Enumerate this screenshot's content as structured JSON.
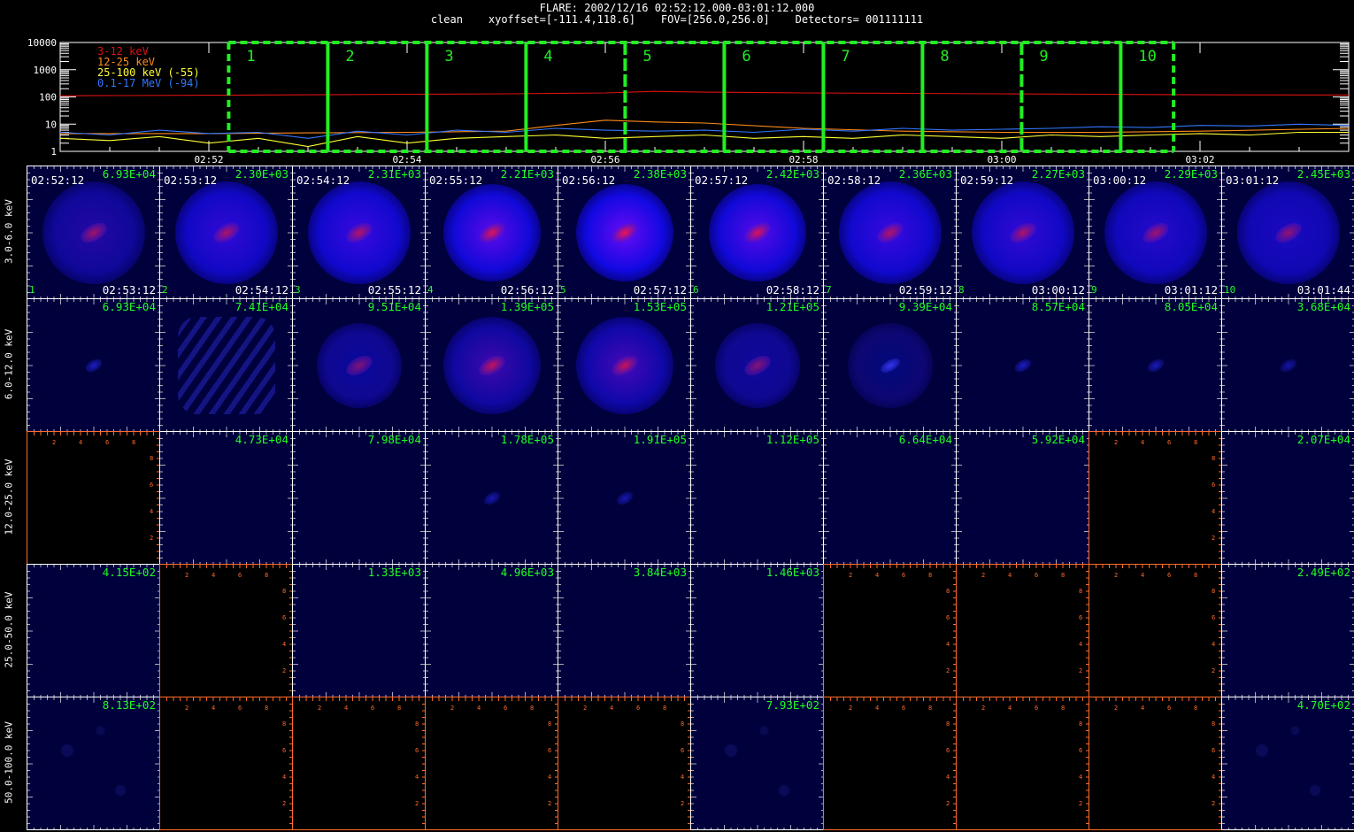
{
  "header": {
    "title": "FLARE: 2002/12/16 02:52:12.000-03:01:12.000",
    "params": "clean    xyoffset=[-111.4,118.6]    FOV=[256.0,256.0]    Detectors= 001111111"
  },
  "chart_data": [
    {
      "type": "line",
      "title": "",
      "xlabel": "",
      "ylabel": "",
      "y_scale": "log",
      "ylim": [
        1,
        10000
      ],
      "y_tick_labels": [
        "1",
        "10",
        "100",
        "1000",
        "10000"
      ],
      "xlim": [
        "02:50:30",
        "03:03:30"
      ],
      "x_tick_labels": [
        "02:52",
        "02:54",
        "02:56",
        "02:58",
        "03:00",
        "03:02"
      ],
      "legend_position": "top-left",
      "series": [
        {
          "name": "3-12 keV",
          "color": "#dd1111",
          "x": [
            "02:50:30",
            "02:52:00",
            "02:53:00",
            "02:54:00",
            "02:55:00",
            "02:56:00",
            "02:56:30",
            "02:57:00",
            "02:58:00",
            "02:59:00",
            "03:00:00",
            "03:01:00",
            "03:02:00",
            "03:03:30"
          ],
          "y": [
            110,
            115,
            120,
            125,
            130,
            140,
            160,
            150,
            140,
            135,
            130,
            125,
            120,
            118
          ]
        },
        {
          "name": "12-25 keV",
          "color": "#ff8c1a",
          "x": [
            "02:50:30",
            "02:52:00",
            "02:53:00",
            "02:54:00",
            "02:55:00",
            "02:55:30",
            "02:56:00",
            "02:56:30",
            "02:57:00",
            "02:58:00",
            "02:59:00",
            "03:00:00",
            "03:01:00",
            "03:02:00",
            "03:03:30"
          ],
          "y": [
            4.5,
            4.5,
            4.8,
            5,
            5.5,
            9,
            14,
            12,
            11,
            7,
            5.5,
            5,
            5,
            5.5,
            7
          ]
        },
        {
          "name": "25-100 keV (-55)",
          "color": "#ffff33",
          "x": [
            "02:50:30",
            "02:51:00",
            "02:51:30",
            "02:52:00",
            "02:52:30",
            "02:53:00",
            "02:53:30",
            "02:54:00",
            "02:54:30",
            "02:55:00",
            "02:55:30",
            "02:56:00",
            "02:56:30",
            "02:57:00",
            "02:57:30",
            "02:58:00",
            "02:58:30",
            "02:59:00",
            "02:59:30",
            "03:00:00",
            "03:00:30",
            "03:01:00",
            "03:01:30",
            "03:02:00",
            "03:02:30",
            "03:03:00",
            "03:03:30"
          ],
          "y": [
            3,
            2.5,
            3.5,
            2,
            3,
            1.5,
            3.5,
            2,
            3,
            3.5,
            4,
            3,
            3.5,
            4,
            3,
            3.5,
            3,
            4,
            3.5,
            3,
            4,
            3.5,
            4,
            4.5,
            4,
            5,
            5
          ]
        },
        {
          "name": "0.1-17 MeV (-94)",
          "color": "#3377ff",
          "x": [
            "02:50:30",
            "02:51:00",
            "02:51:30",
            "02:52:00",
            "02:52:30",
            "02:53:00",
            "02:53:30",
            "02:54:00",
            "02:54:30",
            "02:55:00",
            "02:55:30",
            "02:56:00",
            "02:56:30",
            "02:57:00",
            "02:57:30",
            "02:58:00",
            "02:58:30",
            "02:59:00",
            "02:59:30",
            "03:00:00",
            "03:00:30",
            "03:01:00",
            "03:01:30",
            "03:02:00",
            "03:02:30",
            "03:03:00",
            "03:03:30"
          ],
          "y": [
            5,
            4,
            6,
            4.5,
            5,
            3,
            5.5,
            4,
            6,
            5,
            7,
            6,
            5.5,
            6,
            5,
            6.5,
            5.5,
            7,
            6,
            6.5,
            7,
            8,
            7.5,
            9,
            8.5,
            10,
            9
          ]
        }
      ],
      "intervals": [
        {
          "label": "1",
          "start": "02:52:12",
          "end": "02:53:12"
        },
        {
          "label": "2",
          "start": "02:53:12",
          "end": "02:54:12"
        },
        {
          "label": "3",
          "start": "02:54:12",
          "end": "02:55:12"
        },
        {
          "label": "4",
          "start": "02:55:12",
          "end": "02:56:12"
        },
        {
          "label": "5",
          "start": "02:56:12",
          "end": "02:57:12"
        },
        {
          "label": "6",
          "start": "02:57:12",
          "end": "02:58:12"
        },
        {
          "label": "7",
          "start": "02:58:12",
          "end": "02:59:12"
        },
        {
          "label": "8",
          "start": "02:59:12",
          "end": "03:00:12"
        },
        {
          "label": "9",
          "start": "03:00:12",
          "end": "03:01:12"
        },
        {
          "label": "10",
          "start": "03:01:12",
          "end": "03:01:44"
        }
      ]
    }
  ],
  "image_grid": {
    "rows": [
      {
        "label": "3.0-6.0 keV",
        "panels": [
          {
            "max": "6.93E+04",
            "start": "02:52:12",
            "index": "1",
            "end": "02:53:12",
            "style": "blue",
            "source": "diffuse",
            "intensity": 0.55,
            "core": 0.35
          },
          {
            "max": "2.30E+03",
            "start": "02:53:12",
            "index": "2",
            "end": "02:54:12",
            "style": "blue",
            "source": "diffuse",
            "intensity": 0.8,
            "core": 0.45
          },
          {
            "max": "2.31E+03",
            "start": "02:54:12",
            "index": "3",
            "end": "02:55:12",
            "style": "blue",
            "source": "diffuse",
            "intensity": 0.85,
            "core": 0.5
          },
          {
            "max": "2.21E+03",
            "start": "02:55:12",
            "index": "4",
            "end": "02:56:12",
            "style": "blue",
            "source": "ring",
            "intensity": 0.9,
            "core": 0.8
          },
          {
            "max": "2.38E+03",
            "start": "02:56:12",
            "index": "5",
            "end": "02:57:12",
            "style": "blue",
            "source": "ring",
            "intensity": 0.95,
            "core": 0.9
          },
          {
            "max": "2.42E+03",
            "start": "02:57:12",
            "index": "6",
            "end": "02:58:12",
            "style": "blue",
            "source": "ring",
            "intensity": 0.9,
            "core": 0.75
          },
          {
            "max": "2.36E+03",
            "start": "02:58:12",
            "index": "7",
            "end": "02:59:12",
            "style": "blue",
            "source": "diffuse",
            "intensity": 0.85,
            "core": 0.5
          },
          {
            "max": "2.27E+03",
            "start": "02:59:12",
            "index": "8",
            "end": "03:00:12",
            "style": "blue",
            "source": "diffuse",
            "intensity": 0.8,
            "core": 0.45
          },
          {
            "max": "2.29E+03",
            "start": "03:00:12",
            "index": "9",
            "end": "03:01:12",
            "style": "blue",
            "source": "diffuse",
            "intensity": 0.75,
            "core": 0.35
          },
          {
            "max": "2.45E+03",
            "start": "03:01:12",
            "index": "10",
            "end": "03:01:44",
            "style": "blue",
            "source": "diffuse",
            "intensity": 0.7,
            "core": 0.25
          }
        ]
      },
      {
        "label": "6.0-12.0 keV",
        "panels": [
          {
            "max": "6.93E+04",
            "style": "blue",
            "source": "point",
            "intensity": 0.3,
            "core": 0
          },
          {
            "max": "7.41E+04",
            "style": "blue",
            "source": "fringes",
            "intensity": 0.35,
            "core": 0
          },
          {
            "max": "9.51E+04",
            "style": "blue",
            "source": "faint-ring",
            "intensity": 0.5,
            "core": 0.1
          },
          {
            "max": "1.39E+05",
            "style": "blue",
            "source": "ring",
            "intensity": 0.6,
            "core": 0.6
          },
          {
            "max": "1.53E+05",
            "style": "blue",
            "source": "ring",
            "intensity": 0.65,
            "core": 0.65
          },
          {
            "max": "1.21E+05",
            "style": "blue",
            "source": "faint-ring",
            "intensity": 0.5,
            "core": 0.15
          },
          {
            "max": "9.39E+04",
            "style": "blue",
            "source": "faint-ring",
            "intensity": 0.3,
            "core": 0
          },
          {
            "max": "8.57E+04",
            "style": "blue",
            "source": "point",
            "intensity": 0.3,
            "core": 0
          },
          {
            "max": "8.05E+04",
            "style": "blue",
            "source": "point",
            "intensity": 0.25,
            "core": 0
          },
          {
            "max": "3.68E+04",
            "style": "blue",
            "source": "point",
            "intensity": 0.15,
            "core": 0
          }
        ]
      },
      {
        "label": "12.0-25.0 keV",
        "panels": [
          {
            "max": "",
            "style": "black"
          },
          {
            "max": "4.73E+04",
            "style": "blue",
            "source": "none"
          },
          {
            "max": "7.98E+04",
            "style": "blue",
            "source": "none"
          },
          {
            "max": "1.78E+05",
            "style": "blue",
            "source": "point",
            "intensity": 0.2,
            "core": 0
          },
          {
            "max": "1.91E+05",
            "style": "blue",
            "source": "point",
            "intensity": 0.2,
            "core": 0
          },
          {
            "max": "1.12E+05",
            "style": "blue",
            "source": "none"
          },
          {
            "max": "6.64E+04",
            "style": "blue",
            "source": "none"
          },
          {
            "max": "5.92E+04",
            "style": "blue",
            "source": "none"
          },
          {
            "max": "",
            "style": "black"
          },
          {
            "max": "2.07E+04",
            "style": "blue",
            "source": "none"
          }
        ]
      },
      {
        "label": "25.0-50.0 keV",
        "panels": [
          {
            "max": "4.15E+02",
            "style": "blue",
            "source": "none"
          },
          {
            "max": "",
            "style": "black"
          },
          {
            "max": "1.33E+03",
            "style": "blue",
            "source": "none"
          },
          {
            "max": "4.96E+03",
            "style": "blue",
            "source": "none"
          },
          {
            "max": "3.84E+03",
            "style": "blue",
            "source": "none"
          },
          {
            "max": "1.46E+03",
            "style": "blue",
            "source": "none"
          },
          {
            "max": "",
            "style": "black"
          },
          {
            "max": "",
            "style": "black"
          },
          {
            "max": "",
            "style": "black"
          },
          {
            "max": "2.49E+02",
            "style": "blue",
            "source": "none"
          }
        ]
      },
      {
        "label": "50.0-100.0 keV",
        "panels": [
          {
            "max": "8.13E+02",
            "style": "blue",
            "source": "noise"
          },
          {
            "max": "",
            "style": "black"
          },
          {
            "max": "",
            "style": "black"
          },
          {
            "max": "",
            "style": "black"
          },
          {
            "max": "",
            "style": "black"
          },
          {
            "max": "7.93E+02",
            "style": "blue",
            "source": "noise"
          },
          {
            "max": "",
            "style": "black"
          },
          {
            "max": "",
            "style": "black"
          },
          {
            "max": "",
            "style": "black"
          },
          {
            "max": "4.70E+02",
            "style": "blue",
            "source": "noise"
          }
        ]
      }
    ],
    "empty_axis_tick_labels": [
      "2",
      "4",
      "6",
      "8"
    ],
    "colors": {
      "panel_bg": "#00003c",
      "label_green": "#22ff22",
      "empty_axis": "#ff6a2a",
      "interval_marker": "#22ee22"
    }
  }
}
